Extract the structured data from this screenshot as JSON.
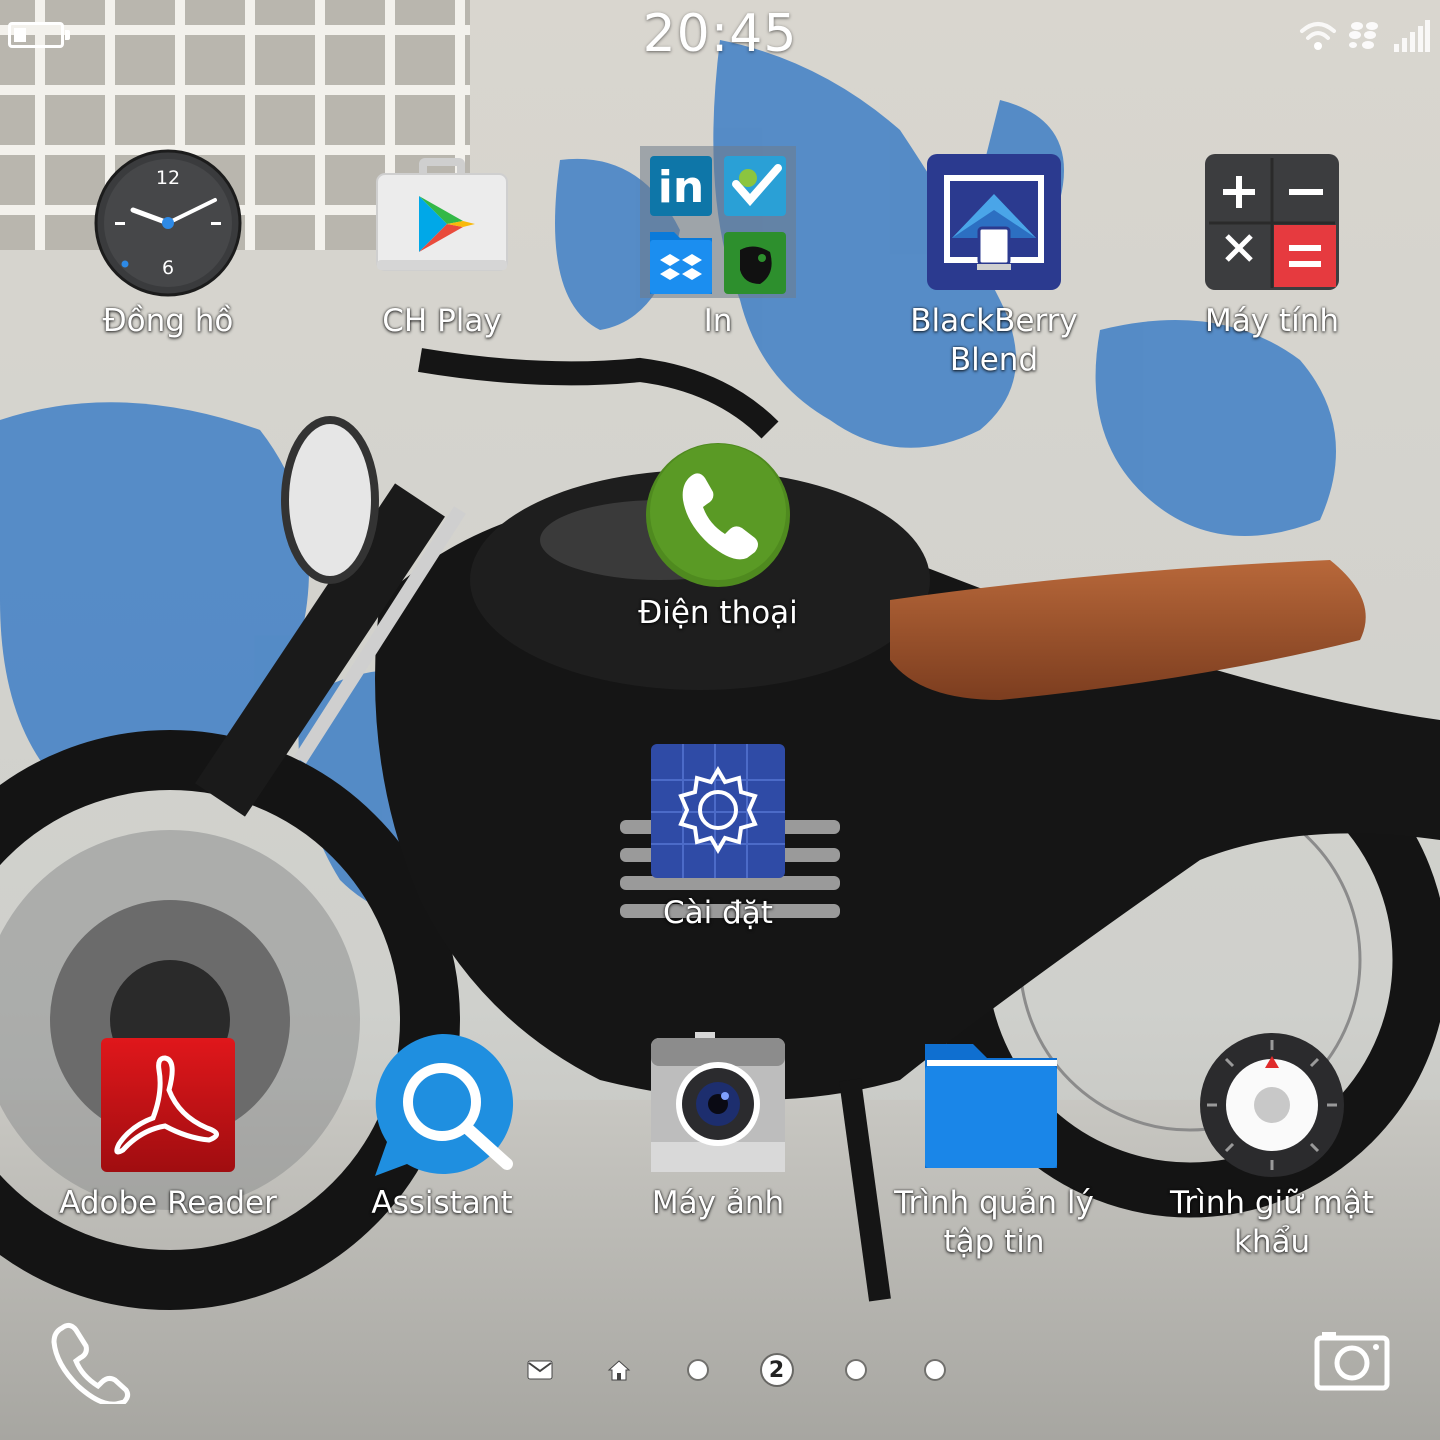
{
  "status_bar": {
    "time": "20:45",
    "icons": [
      "battery-icon",
      "wifi-icon",
      "blackberry-icon",
      "signal-icon"
    ]
  },
  "apps": [
    {
      "id": "clock",
      "label": "Đồng hồ",
      "icon": "clock-icon"
    },
    {
      "id": "play",
      "label": "CH Play",
      "icon": "play-store-icon"
    },
    {
      "id": "print-folder",
      "label": "In",
      "icon": "folder-icon"
    },
    {
      "id": "blend",
      "label": "BlackBerry Blend",
      "icon": "blend-icon"
    },
    {
      "id": "calculator",
      "label": "Máy tính",
      "icon": "calculator-icon"
    },
    {
      "id": "phone",
      "label": "Điện thoại",
      "icon": "phone-icon"
    },
    {
      "id": "settings",
      "label": "Cài đặt",
      "icon": "gear-icon"
    },
    {
      "id": "adobe",
      "label": "Adobe Reader",
      "icon": "adobe-reader-icon"
    },
    {
      "id": "assistant",
      "label": "Assistant",
      "icon": "assistant-icon"
    },
    {
      "id": "camera",
      "label": "Máy ảnh",
      "icon": "camera-icon"
    },
    {
      "id": "files",
      "label": "Trình quản lý tập tin",
      "icon": "folder-icon"
    },
    {
      "id": "password",
      "label": "Trình giữ mật khẩu",
      "icon": "password-keeper-icon"
    }
  ],
  "clock_face": {
    "n12": "12",
    "n6": "6"
  },
  "dock": {
    "current_page": "2",
    "pages": [
      "hub-icon",
      "home-icon",
      "page-1",
      "page-2",
      "page-3",
      "page-4"
    ]
  }
}
